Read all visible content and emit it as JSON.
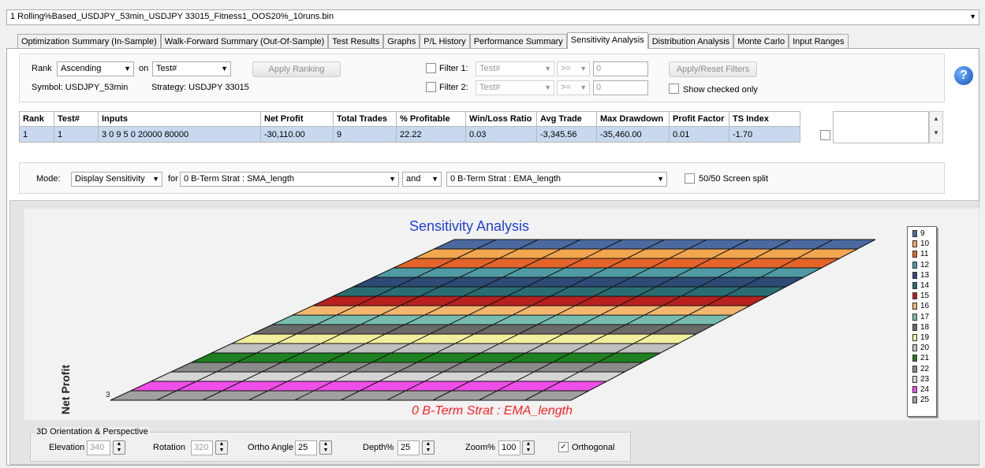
{
  "file_selector": {
    "value": "1 Rolling%Based_USDJPY_53min_USDJPY 33015_Fitness1_OOS20%_10runs.bin"
  },
  "tabs": [
    {
      "label": "Optimization Summary (In-Sample)"
    },
    {
      "label": "Walk-Forward Summary (Out-Of-Sample)"
    },
    {
      "label": "Test Results"
    },
    {
      "label": "Graphs"
    },
    {
      "label": "P/L History"
    },
    {
      "label": "Performance Summary"
    },
    {
      "label": "Sensitivity Analysis",
      "active": true
    },
    {
      "label": "Distribution Analysis"
    },
    {
      "label": "Monte Carlo"
    },
    {
      "label": "Input Ranges"
    }
  ],
  "ranking": {
    "rank_label": "Rank",
    "order": "Ascending",
    "on_label": "on",
    "field": "Test#",
    "apply_label": "Apply Ranking",
    "symbol": "Symbol: USDJPY_53min",
    "strategy": "Strategy: USDJPY 33015"
  },
  "filters": {
    "filter1_label": "Filter 1:",
    "filter1_field": "Test#",
    "filter1_op": ">=",
    "filter1_value": "0",
    "filter2_label": "Filter 2:",
    "filter2_field": "Test#",
    "filter2_op": ">=",
    "filter2_value": "0",
    "apply_reset_label": "Apply/Reset Filters",
    "show_checked_label": "Show checked only"
  },
  "results_table": {
    "columns": [
      "Rank",
      "Test#",
      "Inputs",
      "Net Profit",
      "Total Trades",
      "% Profitable",
      "Win/Loss Ratio",
      "Avg Trade",
      "Max Drawdown",
      "Profit Factor",
      "TS Index"
    ],
    "rows": [
      [
        "1",
        "1",
        "3 0 9 5 0 20000 80000",
        "-30,110.00",
        "9",
        "22.22",
        "0.03",
        "-3,345.56",
        "-35,460.00",
        "0.01",
        "-1.70"
      ]
    ]
  },
  "mode": {
    "mode_label": "Mode:",
    "mode_value": "Display Sensitivity",
    "for_label": "for",
    "param1": "0 B-Term Strat : SMA_length",
    "and_value": "and",
    "param2": "0 B-Term Strat : EMA_length",
    "split_label": "50/50 Screen split"
  },
  "chart": {
    "title": "Sensitivity Analysis",
    "x_axis_label": "0 B-Term Strat : EMA_length",
    "y_axis_label": "Net Profit",
    "corner_label": "3",
    "title_color": "#1f3fdc",
    "axis_color": "#ff2020"
  },
  "chart_data": {
    "type": "area",
    "title": "Sensitivity Analysis",
    "xlabel": "0 B-Term Strat : EMA_length",
    "ylabel": "Net Profit",
    "series": [
      {
        "name": "9",
        "color": "#4a6aa0"
      },
      {
        "name": "10",
        "color": "#f2a650"
      },
      {
        "name": "11",
        "color": "#e5642a"
      },
      {
        "name": "12",
        "color": "#4f9aa3"
      },
      {
        "name": "13",
        "color": "#2e4a76"
      },
      {
        "name": "14",
        "color": "#2a6e73"
      },
      {
        "name": "15",
        "color": "#b82020"
      },
      {
        "name": "16",
        "color": "#f3b56f"
      },
      {
        "name": "17",
        "color": "#78bcb0"
      },
      {
        "name": "18",
        "color": "#6a6a6a"
      },
      {
        "name": "19",
        "color": "#f1ef9e"
      },
      {
        "name": "20",
        "color": "#c0c0c0"
      },
      {
        "name": "21",
        "color": "#1e8020"
      },
      {
        "name": "22",
        "color": "#8a8a8a"
      },
      {
        "name": "23",
        "color": "#d5d5d5"
      },
      {
        "name": "24",
        "color": "#ef4fe8"
      },
      {
        "name": "25",
        "color": "#a0a0a0"
      }
    ]
  },
  "orientation": {
    "group_label": "3D Orientation & Perspective",
    "elevation_label": "Elevation",
    "elevation": "340",
    "rotation_label": "Rotation",
    "rotation": "320",
    "ortho_label": "Ortho Angle",
    "ortho": "25",
    "depth_label": "Depth%",
    "depth": "25",
    "zoom_label": "Zoom%",
    "zoom": "100",
    "orthogonal_label": "Orthogonal"
  }
}
